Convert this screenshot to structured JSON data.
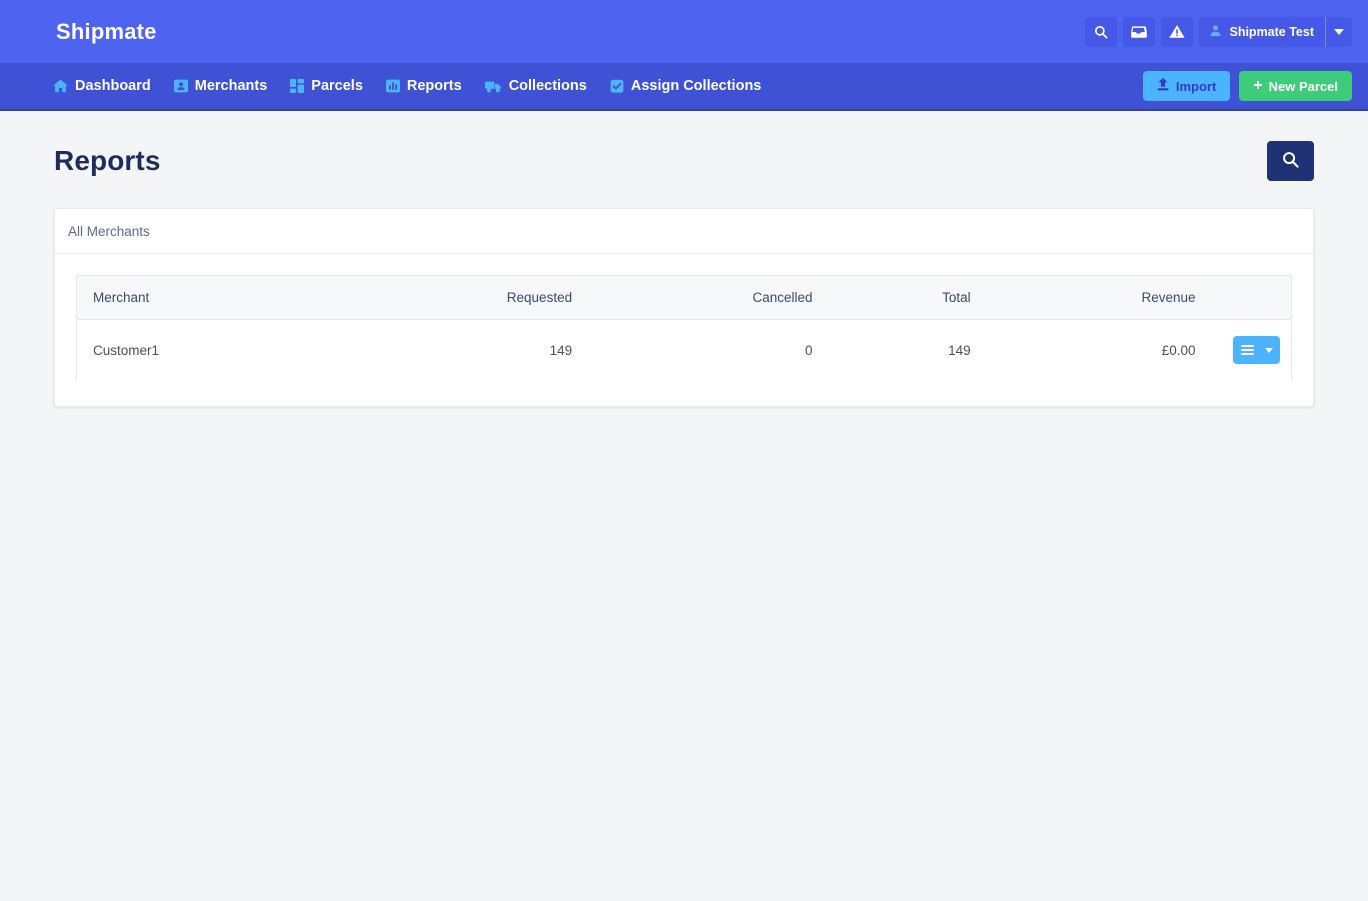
{
  "header": {
    "brand": "Shipmate",
    "icons": [
      {
        "name": "search-icon",
        "title": "Search"
      },
      {
        "name": "inbox-icon",
        "title": "Inbox"
      },
      {
        "name": "warning-icon",
        "title": "Alerts"
      }
    ],
    "user": {
      "label": "Shipmate Test",
      "caret": "▾"
    }
  },
  "nav": {
    "items": [
      {
        "label": "Dashboard",
        "icon": "home-icon"
      },
      {
        "label": "Merchants",
        "icon": "id-card-icon"
      },
      {
        "label": "Parcels",
        "icon": "grid-blocks-icon"
      },
      {
        "label": "Reports",
        "icon": "bar-chart-icon"
      },
      {
        "label": "Collections",
        "icon": "truck-icon"
      },
      {
        "label": "Assign Collections",
        "icon": "clipboard-check-icon"
      }
    ],
    "import_label": "Import",
    "new_parcel_label": "New Parcel",
    "new_parcel_plus": "+"
  },
  "page": {
    "title": "Reports",
    "search_button_icon": "search-icon"
  },
  "card": {
    "header_link": "All Merchants"
  },
  "table": {
    "columns": [
      "Merchant",
      "Requested",
      "Cancelled",
      "Total",
      "Revenue"
    ],
    "rows": [
      {
        "merchant": "Customer1",
        "requested": "149",
        "cancelled": "0",
        "total": "149",
        "revenue": "£0.00",
        "action_icon": "hamburger-menu-icon",
        "action_caret": "▾"
      }
    ]
  },
  "colors": {
    "topbar": "#4e63f0",
    "navbar": "#3f51d4",
    "nav_icon": "#4cb3ff",
    "import_bg": "#4cb3ff",
    "new_parcel_bg": "#3dcc79",
    "search_btn_bg": "#1f3276",
    "page_bg": "#f4f5f7",
    "action_btn_bg": "#4cb3ff"
  }
}
